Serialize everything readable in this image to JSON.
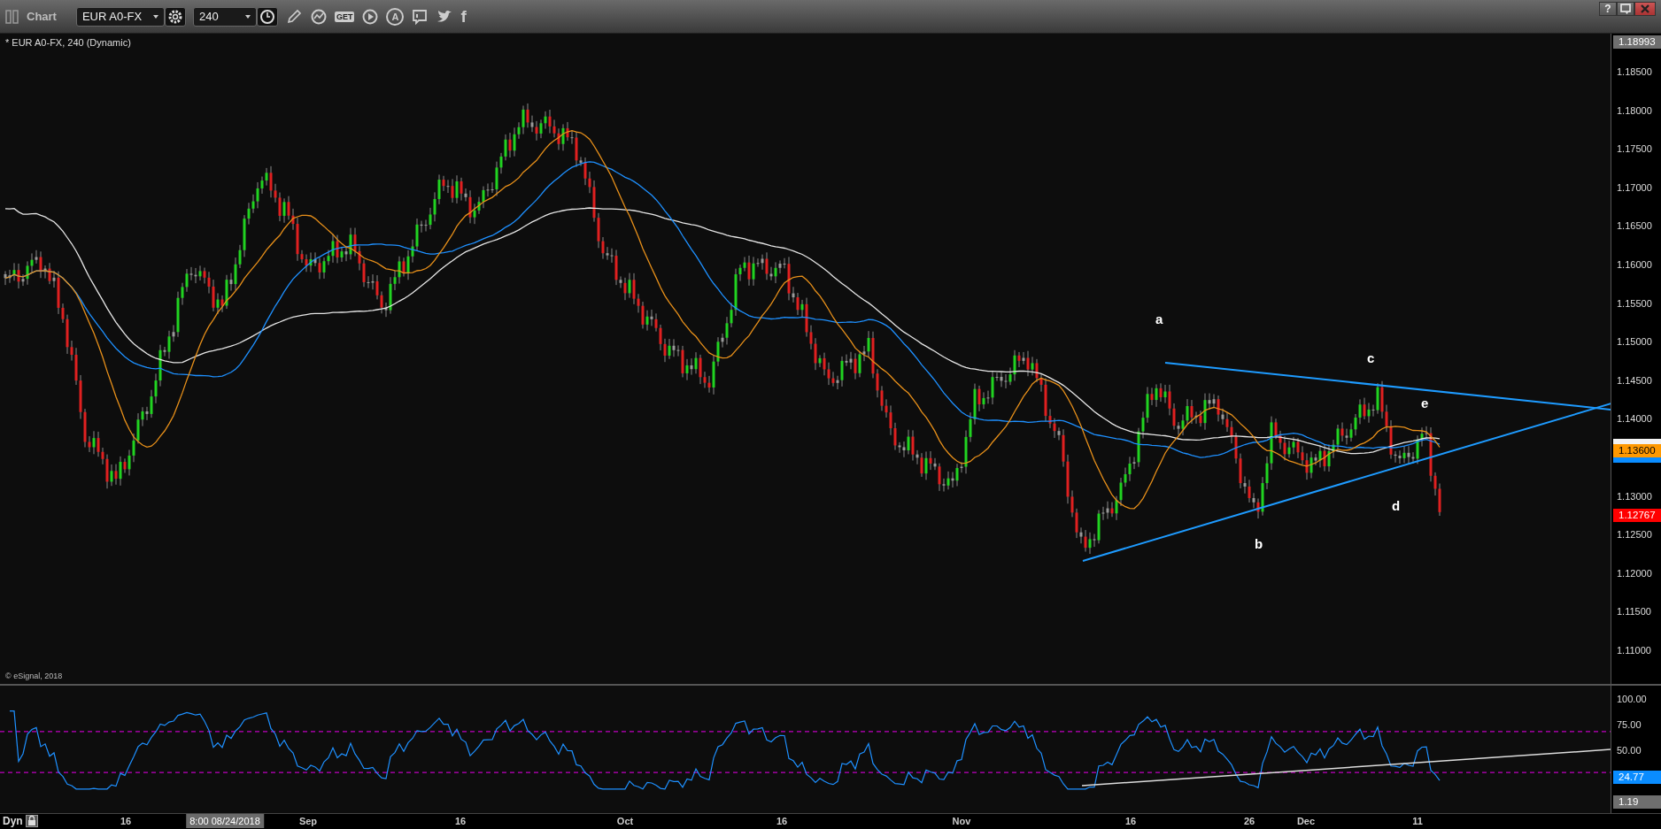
{
  "window": {
    "title": "Chart",
    "help_button": "?"
  },
  "toolbar": {
    "symbol": "EUR A0-FX",
    "interval": "240",
    "get_label": "GET",
    "a_label": "A",
    "facebook_label": "f"
  },
  "chart": {
    "legend": "* EUR A0-FX, 240 (Dynamic)",
    "copyright": "© eSignal, 2018",
    "wave_labels": [
      "a",
      "b",
      "c",
      "d",
      "e"
    ],
    "price_ticks": [
      "1.18500",
      "1.18000",
      "1.17500",
      "1.17000",
      "1.16500",
      "1.16000",
      "1.15500",
      "1.15000",
      "1.14500",
      "1.14000",
      "1.13000",
      "1.12500",
      "1.12000",
      "1.11500",
      "1.11000"
    ],
    "price_tags": [
      {
        "text": "1.18993",
        "color": "#6e6e6e"
      },
      {
        "text": "1.13600",
        "color": "#ff9900"
      },
      {
        "text": "1.12767",
        "color": "#ff0000"
      }
    ]
  },
  "indicator": {
    "ticks": [
      "100.00",
      "75.00",
      "50.00"
    ],
    "tags": [
      {
        "text": "24.77",
        "color": "#0a8cff"
      },
      {
        "text": "1.19",
        "color": "#6e6e6e"
      }
    ]
  },
  "time_axis": {
    "mode": "Dyn",
    "cursor_label": "8:00 08/24/2018",
    "labels": [
      "16",
      "Sep",
      "16",
      "Oct",
      "16",
      "Nov",
      "16",
      "26",
      "Dec",
      "11"
    ]
  }
}
